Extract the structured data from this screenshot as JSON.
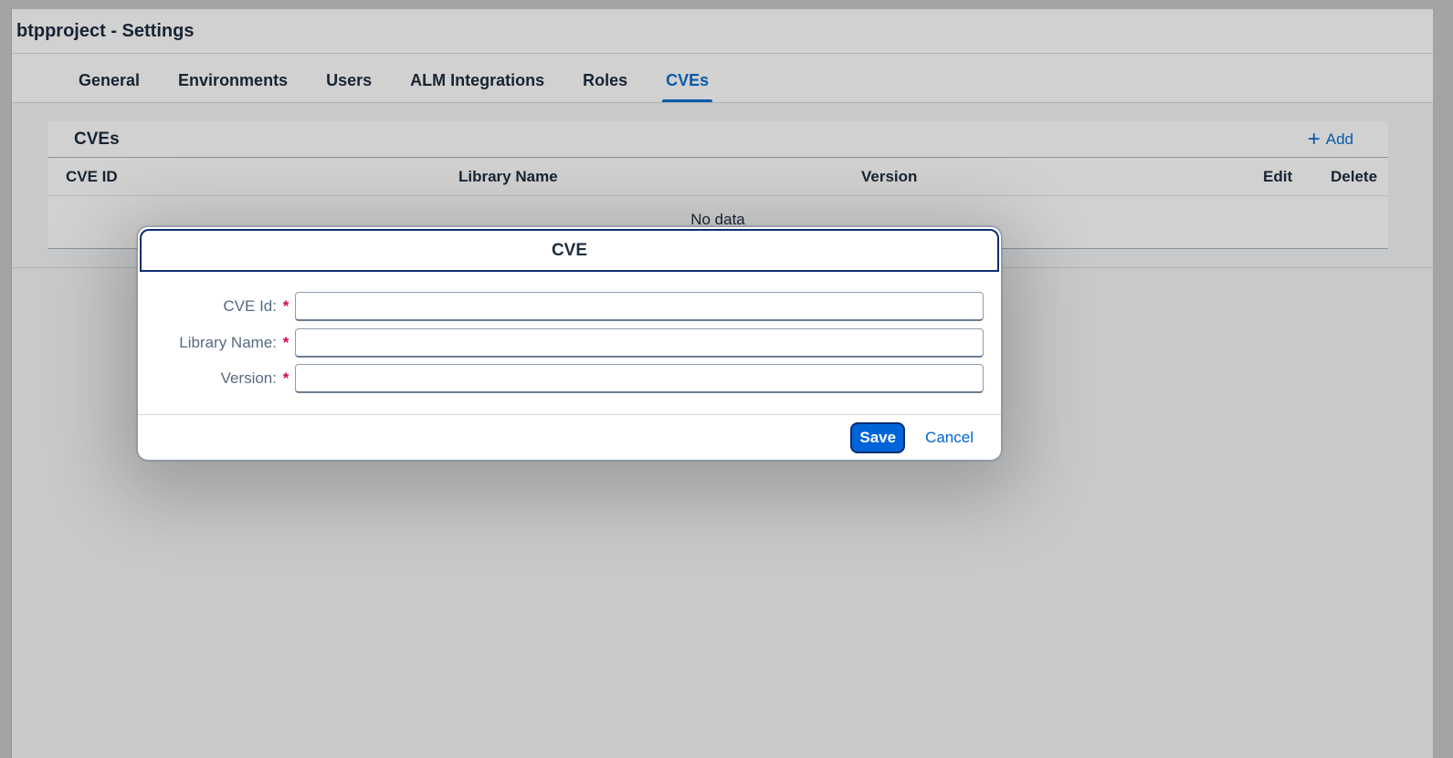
{
  "app": {
    "title": "btpproject - Settings"
  },
  "tabs": [
    {
      "label": "General",
      "active": false
    },
    {
      "label": "Environments",
      "active": false
    },
    {
      "label": "Users",
      "active": false
    },
    {
      "label": "ALM Integrations",
      "active": false
    },
    {
      "label": "Roles",
      "active": false
    },
    {
      "label": "CVEs",
      "active": true
    }
  ],
  "table": {
    "title": "CVEs",
    "add_label": "Add",
    "add_icon": "plus-icon",
    "columns": [
      "CVE ID",
      "Library Name",
      "Version",
      "Edit",
      "Delete"
    ],
    "empty_text": "No data"
  },
  "dialog": {
    "title": "CVE",
    "fields": [
      {
        "label": "CVE Id:",
        "required_marker": "*",
        "value": ""
      },
      {
        "label": "Library Name:",
        "required_marker": "*",
        "value": ""
      },
      {
        "label": "Version:",
        "required_marker": "*",
        "value": ""
      }
    ],
    "save_label": "Save",
    "cancel_label": "Cancel"
  },
  "colors": {
    "accent": "#0a6ed1",
    "required": "#d7005a",
    "save_button": "#0064d9"
  }
}
